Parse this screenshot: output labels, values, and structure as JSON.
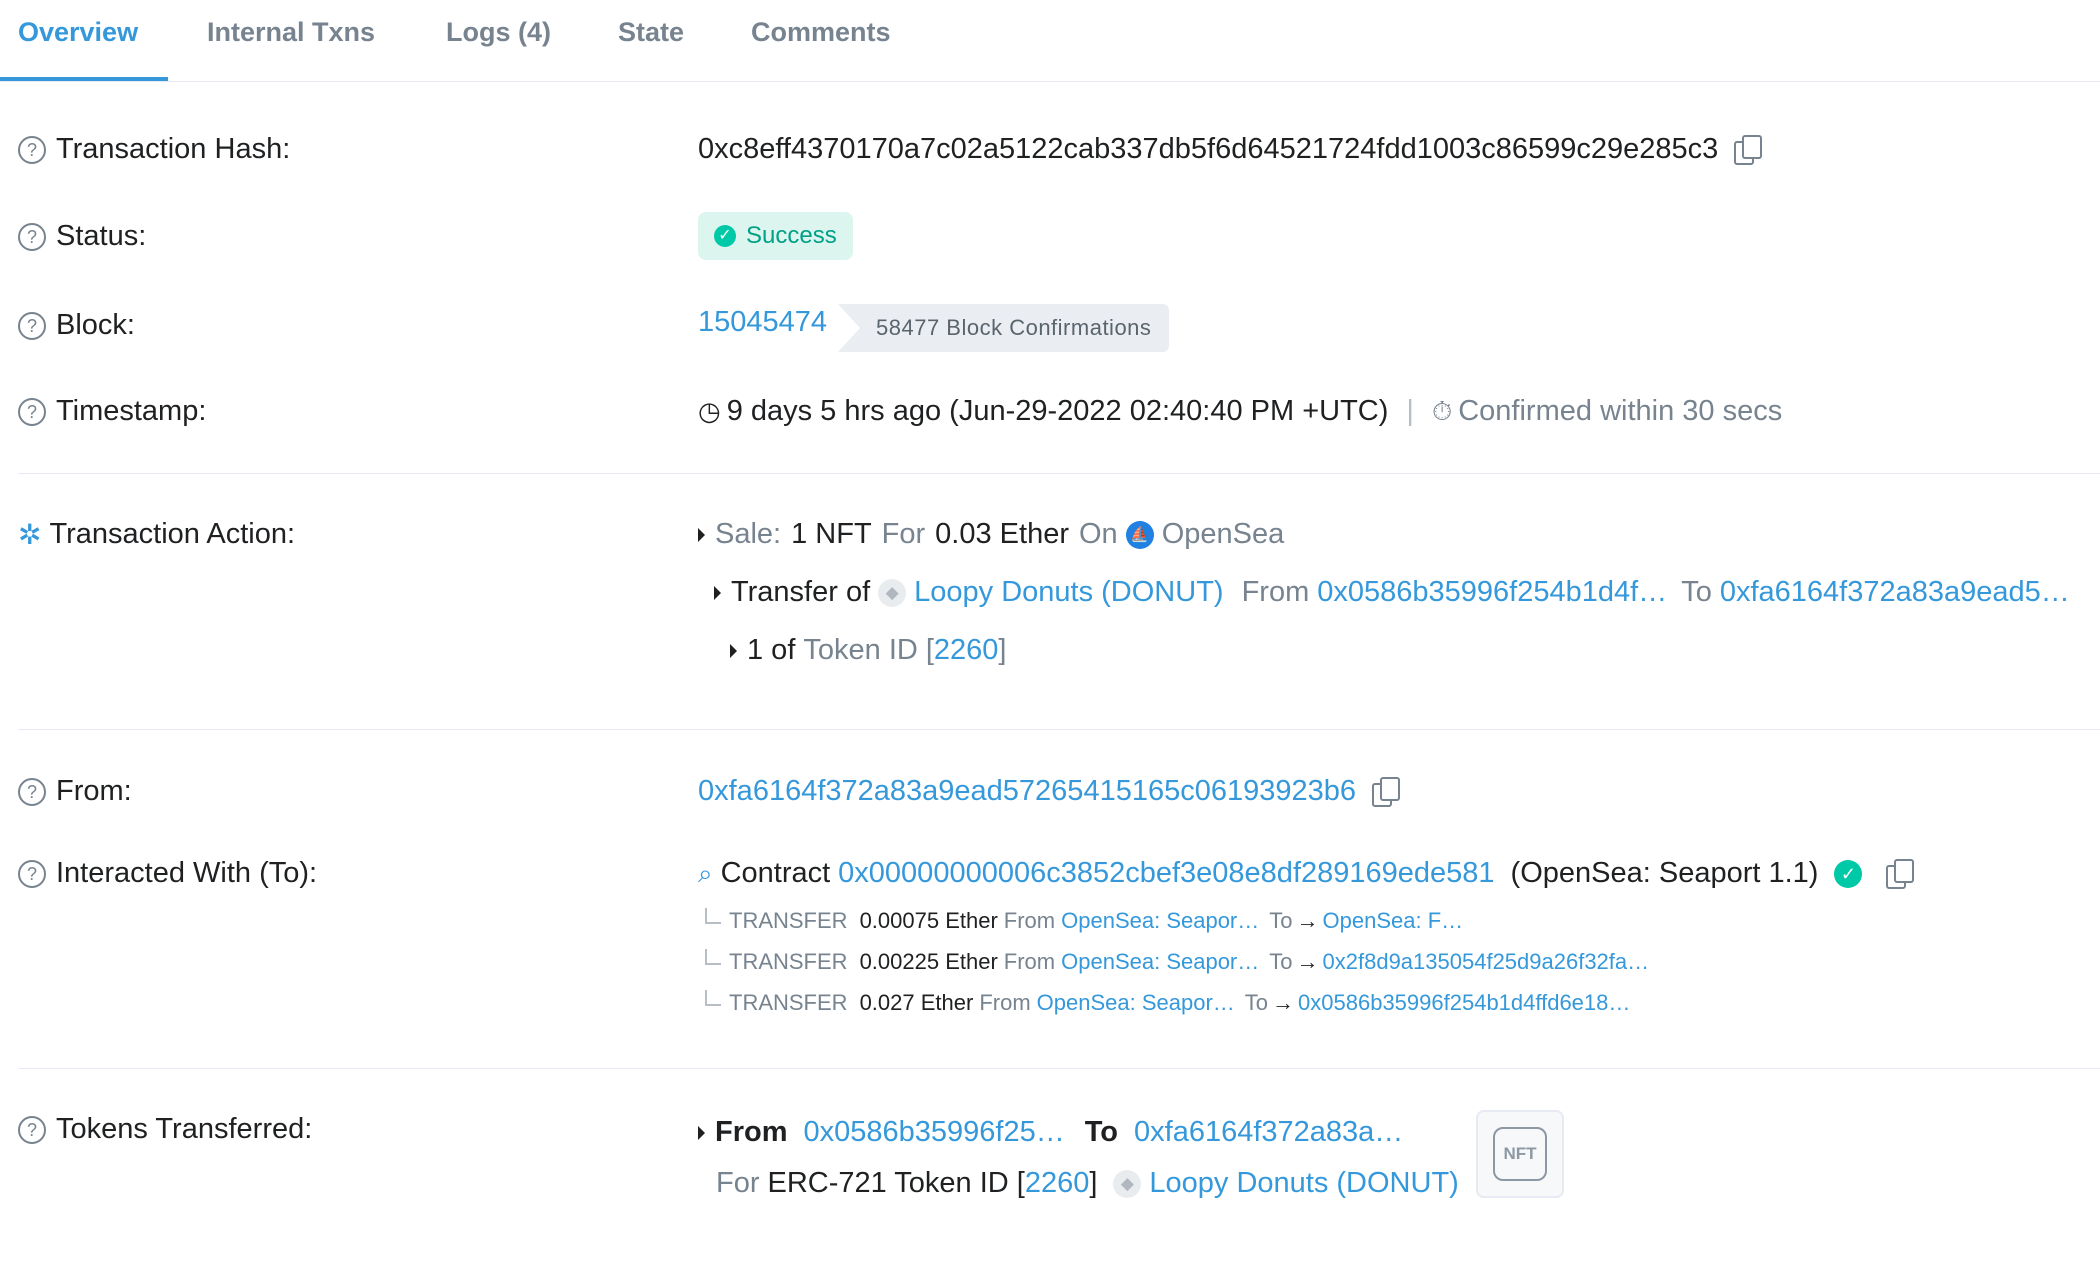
{
  "tabs": [
    {
      "label": "Overview",
      "active": true
    },
    {
      "label": "Internal Txns"
    },
    {
      "label": "Logs (4)"
    },
    {
      "label": "State"
    },
    {
      "label": "Comments"
    }
  ],
  "labels": {
    "tx_hash": "Transaction Hash:",
    "status": "Status:",
    "block": "Block:",
    "timestamp": "Timestamp:",
    "tx_action": "Transaction Action:",
    "from": "From:",
    "interacted": "Interacted With (To):",
    "tokens": "Tokens Transferred:"
  },
  "tx_hash": "0xc8eff4370170a7c02a5122cab337db5f6d64521724fdd1003c86599c29e285c3",
  "status": "Success",
  "block": {
    "number": "15045474",
    "confirmations": "58477 Block Confirmations"
  },
  "timestamp": {
    "age": "9 days 5 hrs ago (Jun-29-2022 02:40:40 PM +UTC)",
    "separator": "|",
    "confirmed": "Confirmed within 30 secs"
  },
  "action": {
    "sale_label": "Sale:",
    "sale_amount": "1 NFT",
    "for": "For",
    "price": "0.03 Ether",
    "on": "On",
    "market": "OpenSea",
    "transfer_of": "Transfer of",
    "collection": "Loopy Donuts (DONUT)",
    "from": "From",
    "from_addr": "0x0586b35996f254b1d4f…",
    "to": "To",
    "to_addr": "0xfa6164f372a83a9ead5…",
    "one_of": "1 of",
    "token_id": "Token ID",
    "token_open": "[",
    "token_num": "2260",
    "token_close": "]"
  },
  "from_address": "0xfa6164f372a83a9ead57265415165c06193923b6",
  "contract": {
    "prefix": "Contract",
    "address": "0x00000000006c3852cbef3e08e8df289169ede581",
    "name": "(OpenSea: Seaport 1.1)"
  },
  "transfers": [
    {
      "type": "TRANSFER",
      "amount": "0.00075 Ether",
      "from": "From",
      "from_addr": "OpenSea: Seapor…",
      "to": "To",
      "to_addr": "OpenSea: F…"
    },
    {
      "type": "TRANSFER",
      "amount": "0.00225 Ether",
      "from": "From",
      "from_addr": "OpenSea: Seapor…",
      "to": "To",
      "to_addr": "0x2f8d9a135054f25d9a26f32fa…"
    },
    {
      "type": "TRANSFER",
      "amount": "0.027 Ether",
      "from": "From",
      "from_addr": "OpenSea: Seapor…",
      "to": "To",
      "to_addr": "0x0586b35996f254b1d4ffd6e18…"
    }
  ],
  "tokens_transferred": {
    "from": "From",
    "from_addr": "0x0586b35996f25…",
    "to": "To",
    "to_addr": "0xfa6164f372a83a…",
    "for": "For",
    "standard": "ERC-721 Token ID",
    "open": "[",
    "token_num": "2260",
    "close": "]",
    "collection": "Loopy Donuts (DONUT)",
    "nft_badge": "NFT"
  },
  "icons": {
    "question": "?",
    "check": "✓",
    "clock": "◷",
    "stopwatch": "⏱",
    "bulb": "✲",
    "eth": "◆",
    "opensea": "⛵",
    "search": "⌕",
    "arrow": "→"
  }
}
